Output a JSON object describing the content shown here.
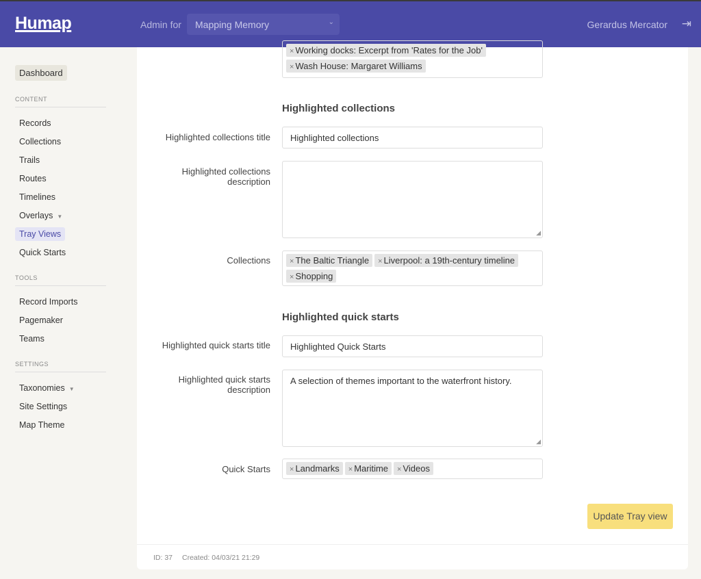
{
  "header": {
    "logo": "Humap",
    "admin_for": "Admin for",
    "project": "Mapping Memory",
    "user": "Gerardus Mercator"
  },
  "sidebar": {
    "dashboard": "Dashboard",
    "content_label": "CONTENT",
    "content": [
      "Records",
      "Collections",
      "Trails",
      "Routes",
      "Timelines",
      "Overlays",
      "Tray Views",
      "Quick Starts"
    ],
    "tools_label": "TOOLS",
    "tools": [
      "Record Imports",
      "Pagemaker",
      "Teams"
    ],
    "settings_label": "SETTINGS",
    "settings": [
      "Taxonomies",
      "Site Settings",
      "Map Theme"
    ],
    "active": "Tray Views"
  },
  "form": {
    "top_tags": [
      "Working docks: Excerpt from 'Rates for the Job'",
      "Wash House: Margaret Williams"
    ],
    "collections_heading": "Highlighted collections",
    "collections_title_label": "Highlighted collections title",
    "collections_title_value": "Highlighted collections",
    "collections_desc_label": "Highlighted collections description",
    "collections_desc_value": "",
    "collections_label": "Collections",
    "collections": [
      "The Baltic Triangle",
      "Liverpool: a 19th-century timeline",
      "Shopping"
    ],
    "qs_heading": "Highlighted quick starts",
    "qs_title_label": "Highlighted quick starts title",
    "qs_title_value": "Highlighted Quick Starts",
    "qs_desc_label": "Highlighted quick starts description",
    "qs_desc_value": "A selection of themes important to the waterfront history.",
    "qs_label": "Quick Starts",
    "quick_starts": [
      "Landmarks",
      "Maritime",
      "Videos"
    ],
    "submit": "Update Tray view"
  },
  "footer": {
    "id": "ID: 37",
    "created": "Created: 04/03/21 21:29"
  },
  "colors": {
    "header": "#4a4aa6",
    "button": "#f8df7d"
  }
}
